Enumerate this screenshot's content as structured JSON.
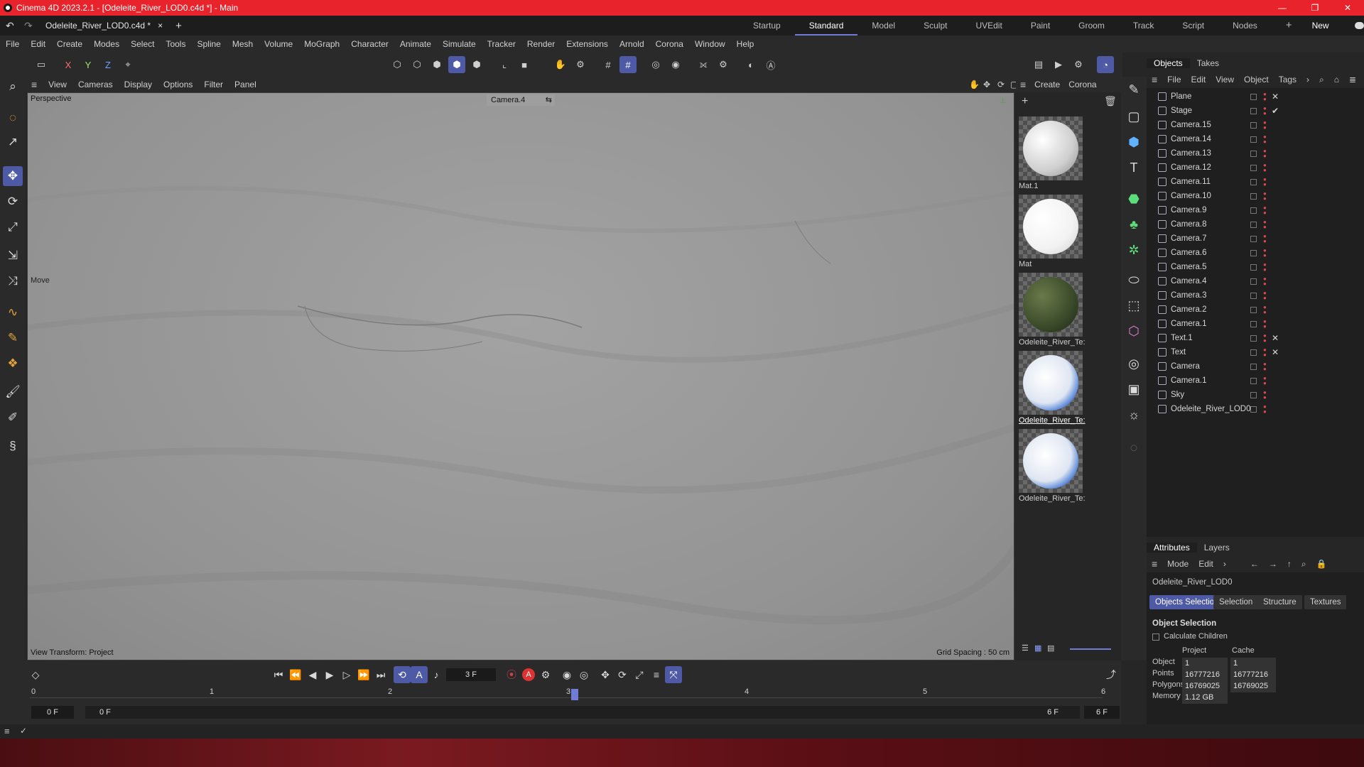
{
  "window": {
    "title": "Cinema 4D 2023.2.1 - [Odeleite_River_LOD0.c4d *] - Main",
    "controls": [
      "—",
      "❐",
      "✕"
    ]
  },
  "doc_tab": {
    "name": "Odeleite_River_LOD0.c4d *",
    "close": "×",
    "add": "+"
  },
  "layouts": {
    "items": [
      "Startup",
      "Standard",
      "Model",
      "Sculpt",
      "UVEdit",
      "Paint",
      "Groom",
      "Track",
      "Script",
      "Nodes"
    ],
    "active": "Standard",
    "add": "+",
    "new_layouts": "New Layouts"
  },
  "menu": [
    "File",
    "Edit",
    "Create",
    "Modes",
    "Select",
    "Tools",
    "Spline",
    "Mesh",
    "Volume",
    "MoGraph",
    "Character",
    "Animate",
    "Simulate",
    "Tracker",
    "Render",
    "Extensions",
    "Arnold",
    "Corona",
    "Window",
    "Help"
  ],
  "axis_buttons": [
    "X",
    "Y",
    "Z"
  ],
  "viewport_menu": [
    "View",
    "Cameras",
    "Display",
    "Options",
    "Filter",
    "Panel"
  ],
  "viewport": {
    "label": "Perspective",
    "camera": "Camera.4",
    "tool_label": "Move",
    "view_transform": "View Transform: Project",
    "grid_spacing": "Grid Spacing : 50 cm"
  },
  "material_menu": [
    "Create",
    "Corona"
  ],
  "materials": [
    {
      "name": "Mat.1",
      "color": "#e8e8e8"
    },
    {
      "name": "Mat",
      "color": "#ffffff"
    },
    {
      "name": "Odeleite_River_Te:",
      "color": "#3a4a2a"
    },
    {
      "name": "Odeleite_River_Te:",
      "color": "#2f6ad0"
    },
    {
      "name": "Odeleite_River_Te:",
      "color": "#2f6ad0"
    }
  ],
  "objects_tabs": [
    "Objects",
    "Takes"
  ],
  "objects_menu": [
    "File",
    "Edit",
    "View",
    "Object",
    "Tags"
  ],
  "objects": [
    {
      "name": "Plane",
      "tag": "✕"
    },
    {
      "name": "Stage",
      "tag": "✔"
    },
    {
      "name": "Camera.15",
      "tag": ""
    },
    {
      "name": "Camera.14",
      "tag": ""
    },
    {
      "name": "Camera.13",
      "tag": ""
    },
    {
      "name": "Camera.12",
      "tag": ""
    },
    {
      "name": "Camera.11",
      "tag": ""
    },
    {
      "name": "Camera.10",
      "tag": ""
    },
    {
      "name": "Camera.9",
      "tag": ""
    },
    {
      "name": "Camera.8",
      "tag": ""
    },
    {
      "name": "Camera.7",
      "tag": ""
    },
    {
      "name": "Camera.6",
      "tag": ""
    },
    {
      "name": "Camera.5",
      "tag": ""
    },
    {
      "name": "Camera.4",
      "tag": ""
    },
    {
      "name": "Camera.3",
      "tag": ""
    },
    {
      "name": "Camera.2",
      "tag": ""
    },
    {
      "name": "Camera.1",
      "tag": ""
    },
    {
      "name": "Text.1",
      "tag": "✕"
    },
    {
      "name": "Text",
      "tag": "✕"
    },
    {
      "name": "Camera",
      "tag": ""
    },
    {
      "name": "Camera.1",
      "tag": ""
    },
    {
      "name": "Sky",
      "tag": ""
    },
    {
      "name": "Odeleite_River_LOD0",
      "tag": ""
    }
  ],
  "attributes": {
    "tabs": [
      "Attributes",
      "Layers"
    ],
    "menu": [
      "Mode",
      "Edit"
    ],
    "object_name": "Odeleite_River_LOD0",
    "subtabs": [
      "Objects Selection",
      "Selection",
      "Structure",
      "Textures"
    ],
    "section": "Object Selection",
    "calc_children": "Calculate Children",
    "col_project": "Project",
    "col_cache": "Cache",
    "rows": [
      {
        "label": "Object",
        "project": "1",
        "cache": "1"
      },
      {
        "label": "Points",
        "project": "16777216",
        "cache": "16777216"
      },
      {
        "label": "Polygons",
        "project": "16769025",
        "cache": "16769025"
      },
      {
        "label": "Memory",
        "project": "1.12 GB",
        "cache": ""
      }
    ]
  },
  "timeline": {
    "current_frame": "3 F",
    "ticks": [
      "0",
      "1",
      "2",
      "3",
      "4",
      "5",
      "6"
    ],
    "start_a": "0 F",
    "start_b": "0 F",
    "end_a": "6 F",
    "end_b": "6 F"
  },
  "colors": {
    "title_bar": "#e8232b",
    "accent": "#4e5aa6"
  }
}
